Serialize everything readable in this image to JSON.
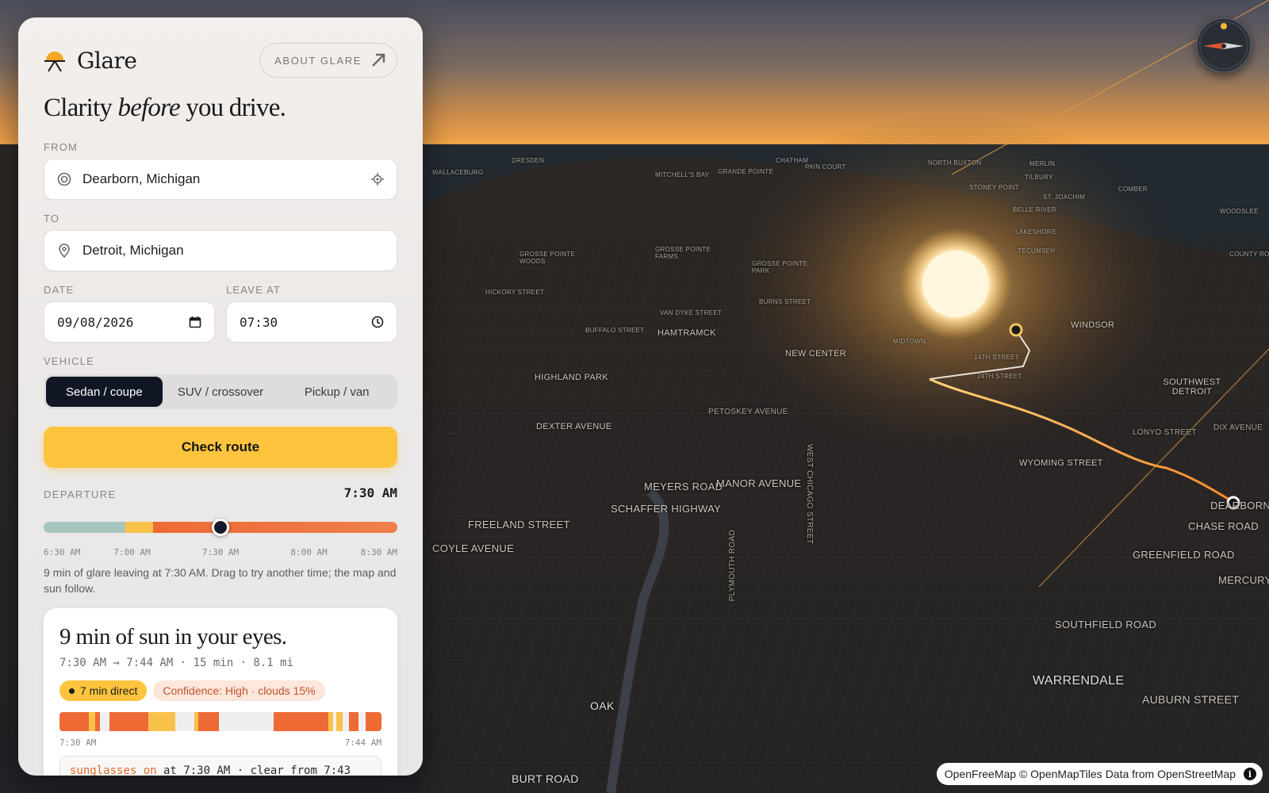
{
  "app": {
    "name": "Glare",
    "about_label": "ABOUT GLARE",
    "tagline_pre": "Clarity ",
    "tagline_em": "before",
    "tagline_post": " you drive."
  },
  "form": {
    "from_label": "FROM",
    "from_value": "Dearborn, Michigan",
    "to_label": "TO",
    "to_value": "Detroit, Michigan",
    "date_label": "DATE",
    "date_value": "09/08/2026",
    "time_label": "LEAVE AT",
    "time_value": "07:30",
    "vehicle_label": "VEHICLE",
    "vehicles": [
      "Sedan / coupe",
      "SUV / crossover",
      "Pickup / van"
    ],
    "vehicle_selected": "Sedan / coupe",
    "submit_label": "Check route"
  },
  "departure": {
    "label": "DEPARTURE",
    "value": "7:30 AM",
    "slider_position_fraction": 0.5,
    "ticks": [
      "6:30 AM",
      "7:00 AM",
      "7:30 AM",
      "8:00 AM",
      "8:30 AM"
    ],
    "hint": "9 min of glare leaving at 7:30 AM. Drag to try another time; the map and sun follow."
  },
  "result": {
    "title": "9 min of sun in your eyes.",
    "summary": "7:30 AM → 7:44 AM · 15 min · 8.1 mi",
    "badge_direct": "7 min direct",
    "badge_confidence": "Confidence: High · clouds 15%",
    "timeline_start": "7:30 AM",
    "timeline_end": "7:44 AM",
    "advice_warn": "sunglasses on",
    "advice_rest": " at 7:30 AM · clear from 7:43"
  },
  "map": {
    "attribution_a": "OpenFreeMap © OpenMapTiles",
    "attribution_b": "Data from",
    "attribution_c": "OpenStreetMap",
    "labels": [
      "DRESDEN",
      "WALLACEBURG",
      "MITCHELL'S BAY",
      "GRANDE POINTE",
      "CHATHAM",
      "PAIN COURT",
      "NORTH BUXTON",
      "MERLIN",
      "TILBURY",
      "STONEY POINT",
      "COMBER",
      "ST. JOACHIM",
      "BELLE RIVER",
      "WOODSLEE",
      "LAKESHORE",
      "TECUMSEH",
      "COUNTY ROAD",
      "GROSSE POINTE WOODS",
      "GROSSE POINTE FARMS",
      "GROSSE POINTE PARK",
      "HICKORY STREET",
      "VAN DYKE STREET",
      "BURNS STREET",
      "BUFFALO STREET",
      "HAMTRAMCK",
      "MIDTOWN",
      "WINDSOR",
      "NEW CENTER",
      "14TH STREET",
      "24TH STREET",
      "HIGHLAND PARK",
      "SOUTHWEST DETROIT",
      "DEXTER AVENUE",
      "MEYERS ROAD",
      "MANOR AVENUE",
      "SCHAFFER HIGHWAY",
      "WEST CHICAGO STREET",
      "FREELAND STREET",
      "COYLE AVENUE",
      "PLYMOUTH ROAD",
      "WYOMING STREET",
      "CHASE ROAD",
      "DEARBORN",
      "GREENFIELD ROAD",
      "SOUTHFIELD ROAD",
      "WARRENDALE",
      "AUBURN STREET",
      "OAK",
      "BURT ROAD",
      "PETOSKEY AVENUE",
      "DIX AVENUE",
      "LONYO STREET",
      "MERCURY"
    ]
  }
}
